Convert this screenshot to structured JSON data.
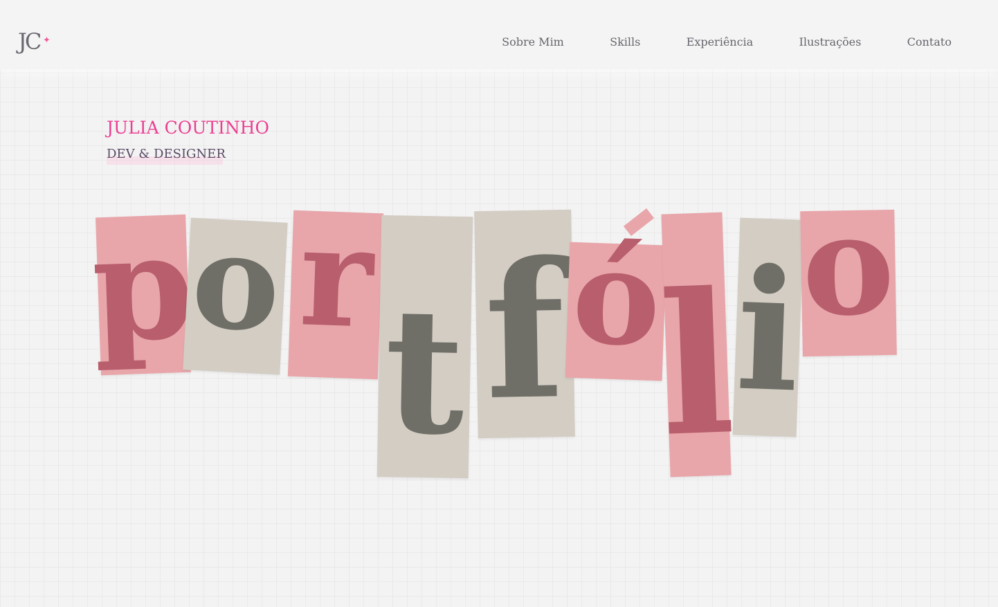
{
  "logo": {
    "letters": "JC",
    "star": "✦",
    "star_color": "#ef5a9c"
  },
  "nav": {
    "items": [
      {
        "label": "Sobre Mim"
      },
      {
        "label": "Skills"
      },
      {
        "label": "Experiência"
      },
      {
        "label": "Ilustrações"
      },
      {
        "label": "Contato"
      }
    ]
  },
  "hero": {
    "name": "JULIA COUTINHO",
    "role": "DEV & DESIGNER",
    "title_letters": [
      "p",
      "o",
      "r",
      "t",
      "f",
      "ó",
      "l",
      "i",
      "o"
    ]
  },
  "colors": {
    "accent_pink": "#ec3f92",
    "paper_pink": "#e8a6aa",
    "paper_grey": "#d3cdc4",
    "ink_pink": "#b85e6c",
    "ink_grey": "#6f6e67"
  }
}
